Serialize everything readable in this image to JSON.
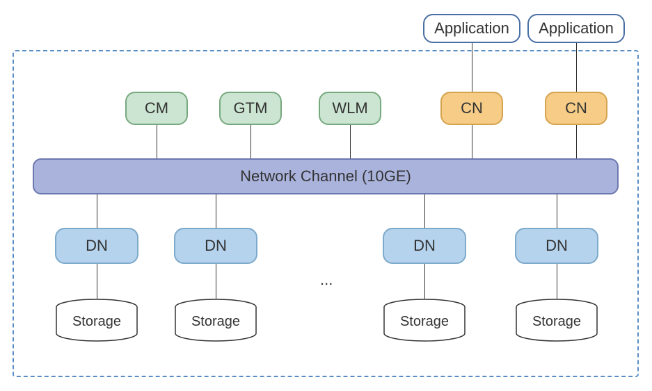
{
  "apps": [
    {
      "label": "Application"
    },
    {
      "label": "Application"
    }
  ],
  "top_row": {
    "cm": "CM",
    "gtm": "GTM",
    "wlm": "WLM",
    "cn1": "CN",
    "cn2": "CN"
  },
  "network": {
    "label": "Network Channel (10GE)"
  },
  "dn_row": {
    "dn1": "DN",
    "dn2": "DN",
    "dn3": "DN",
    "dn4": "DN"
  },
  "storage_row": {
    "s1": "Storage",
    "s2": "Storage",
    "s3": "Storage",
    "s4": "Storage"
  },
  "ellipsis": "..."
}
